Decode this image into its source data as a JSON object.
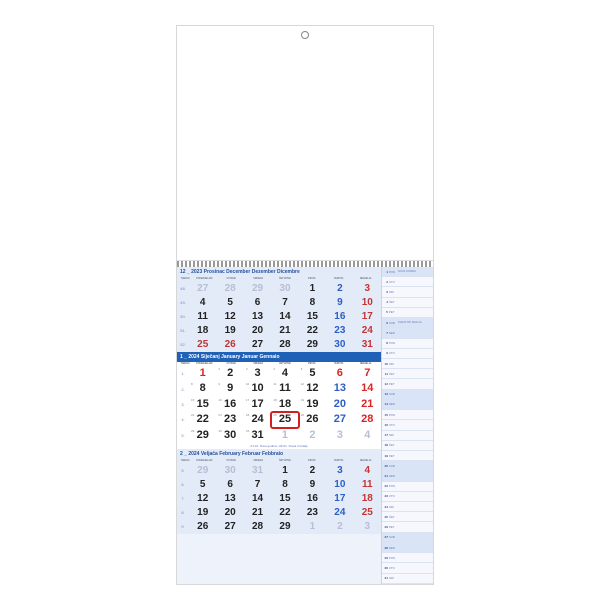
{
  "months": {
    "dec": {
      "title": "12 _ 2023 Prosinac December Dezember Dicembre",
      "dow": [
        "TJEDAN",
        "PONEDJELJAK",
        "UTORAK",
        "SRIJEDA",
        "ČETVRTAK",
        "PETAK",
        "SUBOTA",
        "NEDJELJA"
      ],
      "rows": [
        {
          "wk": "48.",
          "c": [
            {
              "n": "27",
              "dim": 1
            },
            {
              "n": "28",
              "dim": 1
            },
            {
              "n": "29",
              "dim": 1
            },
            {
              "n": "30",
              "dim": 1
            },
            {
              "n": "1"
            },
            {
              "n": "2",
              "s": 1
            },
            {
              "n": "3",
              "u": 1
            }
          ]
        },
        {
          "wk": "49.",
          "c": [
            {
              "n": "4"
            },
            {
              "n": "5"
            },
            {
              "n": "6"
            },
            {
              "n": "7"
            },
            {
              "n": "8"
            },
            {
              "n": "9",
              "s": 1
            },
            {
              "n": "10",
              "u": 1
            }
          ]
        },
        {
          "wk": "50.",
          "c": [
            {
              "n": "11"
            },
            {
              "n": "12"
            },
            {
              "n": "13"
            },
            {
              "n": "14"
            },
            {
              "n": "15"
            },
            {
              "n": "16",
              "s": 1
            },
            {
              "n": "17",
              "u": 1
            }
          ]
        },
        {
          "wk": "51.",
          "c": [
            {
              "n": "18"
            },
            {
              "n": "19"
            },
            {
              "n": "20"
            },
            {
              "n": "21"
            },
            {
              "n": "22"
            },
            {
              "n": "23",
              "s": 1
            },
            {
              "n": "24",
              "u": 1
            }
          ]
        },
        {
          "wk": "52.",
          "c": [
            {
              "n": "25",
              "u": 1
            },
            {
              "n": "26",
              "u": 1
            },
            {
              "n": "27"
            },
            {
              "n": "28"
            },
            {
              "n": "29"
            },
            {
              "n": "30",
              "s": 1
            },
            {
              "n": "31",
              "u": 1
            }
          ]
        }
      ]
    },
    "jan": {
      "title": "1 _ 2024 Siječanj January Januar Gennaio",
      "dow": [
        "TJEDAN",
        "PONEDJELJAK",
        "UTORAK",
        "SRIJEDA",
        "ČETVRTAK",
        "PETAK",
        "SUBOTA",
        "NEDJELJA"
      ],
      "rows": [
        {
          "wk": "1.",
          "c": [
            {
              "n": "1",
              "u": 1
            },
            {
              "n": "2",
              "t": "2"
            },
            {
              "n": "3",
              "t": "3"
            },
            {
              "n": "4",
              "t": "4"
            },
            {
              "n": "5",
              "t": "5"
            },
            {
              "n": "6",
              "s": 1,
              "u": 1
            },
            {
              "n": "7",
              "u": 1
            }
          ]
        },
        {
          "wk": "2.",
          "c": [
            {
              "n": "8",
              "t": "8"
            },
            {
              "n": "9",
              "t": "9"
            },
            {
              "n": "10",
              "t": "10"
            },
            {
              "n": "11",
              "t": "11"
            },
            {
              "n": "12",
              "t": "12"
            },
            {
              "n": "13",
              "s": 1
            },
            {
              "n": "14",
              "u": 1
            }
          ]
        },
        {
          "wk": "3.",
          "c": [
            {
              "n": "15",
              "t": "15"
            },
            {
              "n": "16",
              "t": "16"
            },
            {
              "n": "17",
              "t": "17"
            },
            {
              "n": "18",
              "t": "18"
            },
            {
              "n": "19",
              "t": "19"
            },
            {
              "n": "20",
              "s": 1
            },
            {
              "n": "21",
              "u": 1
            }
          ]
        },
        {
          "wk": "4.",
          "c": [
            {
              "n": "22",
              "t": "22"
            },
            {
              "n": "23",
              "t": "23"
            },
            {
              "n": "24",
              "t": "24"
            },
            {
              "n": "25",
              "t": "25",
              "mark": 1
            },
            {
              "n": "26",
              "t": "26"
            },
            {
              "n": "27",
              "s": 1
            },
            {
              "n": "28",
              "u": 1
            }
          ]
        },
        {
          "wk": "5.",
          "c": [
            {
              "n": "29",
              "t": "29"
            },
            {
              "n": "30",
              "t": "30"
            },
            {
              "n": "31",
              "t": "31"
            },
            {
              "n": "1",
              "dim": 1
            },
            {
              "n": "2",
              "dim": 1
            },
            {
              "n": "3",
              "dim": 1
            },
            {
              "n": "4",
              "dim": 1
            }
          ]
        }
      ],
      "footnote": "01.01. Nova godina • 06.01. Sveta tri kralja"
    },
    "feb": {
      "title": "2 _ 2024 Veljača February Februar Febbraio",
      "dow": [
        "TJEDAN",
        "PONEDJELJAK",
        "UTORAK",
        "SRIJEDA",
        "ČETVRTAK",
        "PETAK",
        "SUBOTA",
        "NEDJELJA"
      ],
      "rows": [
        {
          "wk": "5.",
          "c": [
            {
              "n": "29",
              "dim": 1
            },
            {
              "n": "30",
              "dim": 1
            },
            {
              "n": "31",
              "dim": 1
            },
            {
              "n": "1"
            },
            {
              "n": "2"
            },
            {
              "n": "3",
              "s": 1
            },
            {
              "n": "4",
              "u": 1
            }
          ]
        },
        {
          "wk": "6.",
          "c": [
            {
              "n": "5"
            },
            {
              "n": "6"
            },
            {
              "n": "7"
            },
            {
              "n": "8"
            },
            {
              "n": "9"
            },
            {
              "n": "10",
              "s": 1
            },
            {
              "n": "11",
              "u": 1
            }
          ]
        },
        {
          "wk": "7.",
          "c": [
            {
              "n": "12"
            },
            {
              "n": "13"
            },
            {
              "n": "14"
            },
            {
              "n": "15"
            },
            {
              "n": "16"
            },
            {
              "n": "17",
              "s": 1
            },
            {
              "n": "18",
              "u": 1
            }
          ]
        },
        {
          "wk": "8.",
          "c": [
            {
              "n": "19"
            },
            {
              "n": "20"
            },
            {
              "n": "21"
            },
            {
              "n": "22"
            },
            {
              "n": "23"
            },
            {
              "n": "24",
              "s": 1
            },
            {
              "n": "25",
              "u": 1
            }
          ]
        },
        {
          "wk": "9.",
          "c": [
            {
              "n": "26"
            },
            {
              "n": "27"
            },
            {
              "n": "28"
            },
            {
              "n": "29"
            },
            {
              "n": "1",
              "dim": 1
            },
            {
              "n": "2",
              "dim": 1
            },
            {
              "n": "3",
              "dim": 1
            }
          ]
        }
      ]
    }
  },
  "marker_day": "25",
  "notes_col": [
    {
      "n": "1",
      "d": "PON",
      "t": "NOVA GODINA",
      "hol": 1
    },
    {
      "n": "2",
      "d": "UTO"
    },
    {
      "n": "3",
      "d": "SRI"
    },
    {
      "n": "4",
      "d": "ČET"
    },
    {
      "n": "5",
      "d": "PET"
    },
    {
      "n": "6",
      "d": "SUB",
      "t": "SVETA TRI KRALJA",
      "hol": 1
    },
    {
      "n": "7",
      "d": "NED",
      "hol": 1
    },
    {
      "n": "8",
      "d": "PON"
    },
    {
      "n": "9",
      "d": "UTO"
    },
    {
      "n": "10",
      "d": "SRI"
    },
    {
      "n": "11",
      "d": "ČET"
    },
    {
      "n": "12",
      "d": "PET"
    },
    {
      "n": "13",
      "d": "SUB",
      "hol": 1
    },
    {
      "n": "14",
      "d": "NED",
      "hol": 1
    },
    {
      "n": "15",
      "d": "PON"
    },
    {
      "n": "16",
      "d": "UTO"
    },
    {
      "n": "17",
      "d": "SRI"
    },
    {
      "n": "18",
      "d": "ČET"
    },
    {
      "n": "19",
      "d": "PET"
    },
    {
      "n": "20",
      "d": "SUB",
      "hol": 1
    },
    {
      "n": "21",
      "d": "NED",
      "hol": 1
    },
    {
      "n": "22",
      "d": "PON"
    },
    {
      "n": "23",
      "d": "UTO"
    },
    {
      "n": "24",
      "d": "SRI"
    },
    {
      "n": "25",
      "d": "ČET"
    },
    {
      "n": "26",
      "d": "PET"
    },
    {
      "n": "27",
      "d": "SUB",
      "hol": 1
    },
    {
      "n": "28",
      "d": "NED",
      "hol": 1
    },
    {
      "n": "29",
      "d": "PON"
    },
    {
      "n": "30",
      "d": "UTO"
    },
    {
      "n": "31",
      "d": "SRI"
    }
  ]
}
